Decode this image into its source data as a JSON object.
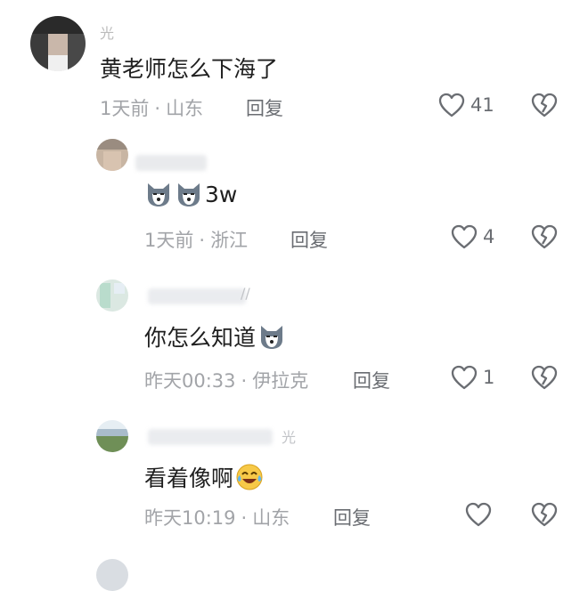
{
  "comments": [
    {
      "name_fragment": "光",
      "text": "黄老师怎么下海了",
      "time": "1天前",
      "location": "山东",
      "reply_label": "回复",
      "likes": "41"
    },
    {
      "name_fragment": "",
      "text": "3w",
      "time": "1天前",
      "location": "浙江",
      "reply_label": "回复",
      "likes": "4"
    },
    {
      "name_fragment": "//",
      "text": "你怎么知道",
      "time": "昨天00:33",
      "location": "伊拉克",
      "reply_label": "回复",
      "likes": "1"
    },
    {
      "name_fragment": "光",
      "text": "看着像啊",
      "time": "昨天10:19",
      "location": "山东",
      "reply_label": "回复",
      "likes": ""
    }
  ],
  "icons": {
    "like": "heart-outline-icon",
    "dislike": "broken-heart-icon",
    "emoji_dog": "husky-dog-emoji-icon",
    "emoji_laugh": "laughing-tears-emoji-icon"
  },
  "colors": {
    "text": "#1f1f1f",
    "meta": "#a2a4a8",
    "icon": "#6a6d72"
  }
}
